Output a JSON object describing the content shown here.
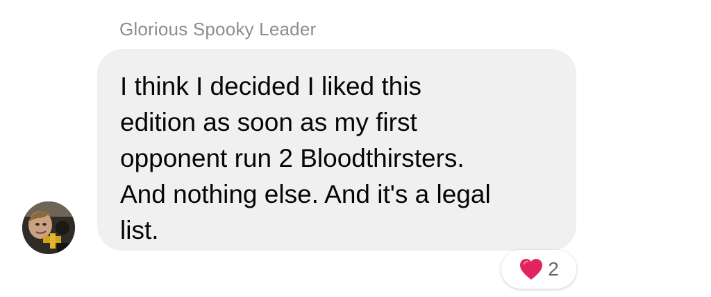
{
  "message": {
    "sender_name": "Glorious Spooky Leader",
    "lines": [
      "I think I decided I liked this",
      "edition as soon as my first",
      "opponent run 2 Bloodthirsters.",
      "And nothing else.  And it's a legal",
      "list."
    ],
    "bubble_color": "#f0f0f0",
    "text_color": "#050505",
    "sender_color": "#8a8d91"
  },
  "avatar": {
    "icon": "user-avatar"
  },
  "reaction": {
    "icon": "heart-icon",
    "color": "#e0245e",
    "count": "2"
  }
}
